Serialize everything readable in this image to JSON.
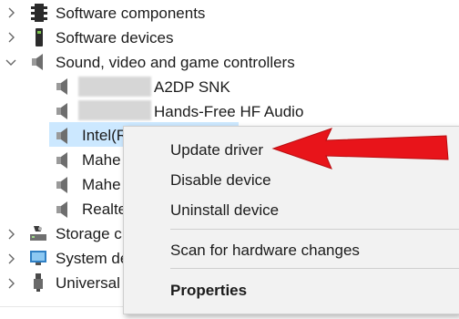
{
  "tree": {
    "items": [
      {
        "label": "Software components",
        "icon": "software-components-icon",
        "expanded": false
      },
      {
        "label": "Software devices",
        "icon": "software-devices-icon",
        "expanded": false
      },
      {
        "label": "Sound, video and game controllers",
        "icon": "speaker-icon",
        "expanded": true
      },
      {
        "label": "A2DP SNK",
        "icon": "speaker-icon"
      },
      {
        "label": "Hands-Free HF Audio",
        "icon": "speaker-icon"
      },
      {
        "label": "Intel(R) Display Audio",
        "icon": "speaker-icon",
        "selected": true
      },
      {
        "label": "Mahe",
        "icon": "speaker-icon"
      },
      {
        "label": "Mahe",
        "icon": "speaker-icon"
      },
      {
        "label": "Realte",
        "icon": "speaker-icon"
      },
      {
        "label": "Storage c",
        "icon": "storage-icon",
        "expanded": false
      },
      {
        "label": "System de",
        "icon": "system-devices-icon",
        "expanded": false
      },
      {
        "label": "Universal",
        "icon": "usb-icon",
        "expanded": false
      }
    ]
  },
  "context_menu": {
    "items": [
      {
        "label": "Update driver"
      },
      {
        "label": "Disable device"
      },
      {
        "label": "Uninstall device"
      },
      {
        "label": "Scan for hardware changes"
      },
      {
        "label": "Properties",
        "bold": true
      }
    ]
  },
  "annotation": {
    "arrow_color": "#e8141a"
  },
  "colors": {
    "selection": "#cce8ff",
    "menu_bg": "#f2f2f2"
  }
}
